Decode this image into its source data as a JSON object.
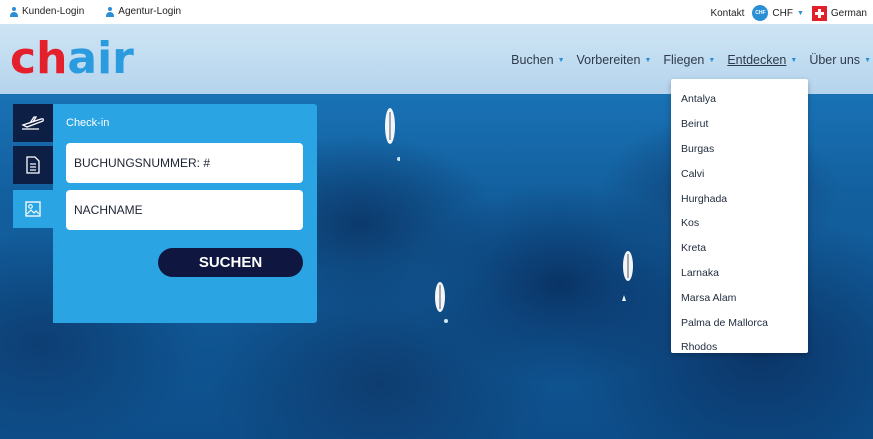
{
  "topbar": {
    "customer_login": "Kunden-Login",
    "agency_login": "Agentur-Login",
    "contact": "Kontakt",
    "currency_badge": "CHF",
    "currency": "CHF",
    "language": "German"
  },
  "logo": {
    "part1": "ch",
    "part2": "air"
  },
  "nav": [
    {
      "label": "Buchen"
    },
    {
      "label": "Vorbereiten"
    },
    {
      "label": "Fliegen"
    },
    {
      "label": "Entdecken"
    },
    {
      "label": "Über uns"
    }
  ],
  "dropdown": [
    "Antalya",
    "Beirut",
    "Burgas",
    "Calvi",
    "Hurghada",
    "Kos",
    "Kreta",
    "Larnaka",
    "Marsa Alam",
    "Palma de Mallorca",
    "Rhodos"
  ],
  "checkin": {
    "title": "Check-in",
    "booking_placeholder": "BUCHUNGSNUMMER: #",
    "name_placeholder": "NACHNAME",
    "search_label": "SUCHEN"
  },
  "icons": {
    "plane": "plane-icon",
    "document": "document-icon",
    "image": "image-icon",
    "user": "user-icon",
    "flag": "swiss-flag-icon"
  },
  "colors": {
    "brand_red": "#e3202b",
    "brand_blue": "#2b9be0",
    "panel_blue": "#2aa4e3",
    "navy": "#0f1740"
  }
}
